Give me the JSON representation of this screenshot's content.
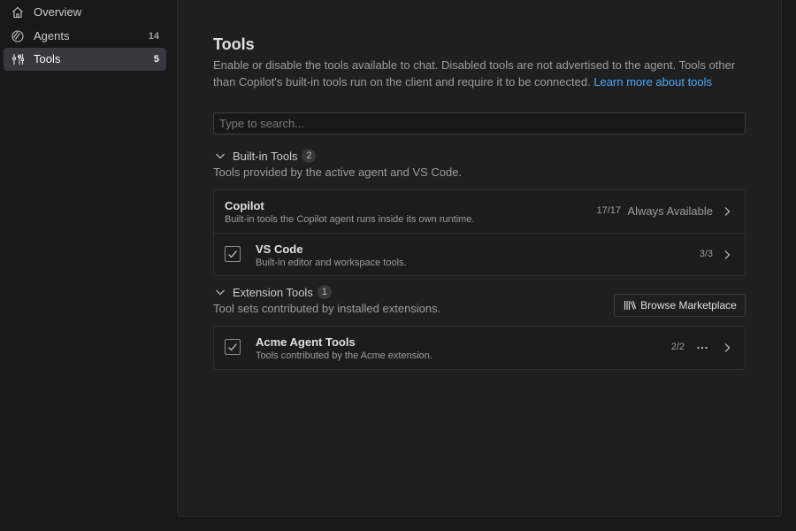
{
  "sidebar": {
    "items": [
      {
        "label": "Overview",
        "icon": "home-icon",
        "count": ""
      },
      {
        "label": "Agents",
        "icon": "agents-icon",
        "count": "14"
      },
      {
        "label": "Tools",
        "icon": "tools-icon",
        "count": "5",
        "active": true
      }
    ]
  },
  "main": {
    "title": "Tools",
    "description": "Enable or disable the tools available to chat. Disabled tools are not advertised to the agent. Tools other than Copilot's built-in tools run on the client and require it to be connected.",
    "learn_more": "Learn more about tools",
    "search_placeholder": "Type to search...",
    "sections": [
      {
        "title": "Built-in Tools",
        "count": "2",
        "description": "Tools provided by the active agent and VS Code.",
        "items": [
          {
            "name": "Copilot",
            "description": "Built-in tools the Copilot agent runs inside its own runtime.",
            "count": "17/17",
            "status": "Always Available",
            "checkbox": false
          },
          {
            "name": "VS Code",
            "description": "Built-in editor and workspace tools.",
            "count": "3/3",
            "checkbox": true,
            "checked": true
          }
        ]
      },
      {
        "title": "Extension Tools",
        "count": "1",
        "description": "Tool sets contributed by installed extensions.",
        "action_label": "Browse Marketplace",
        "items": [
          {
            "name": "Acme Agent Tools",
            "description": "Tools contributed by the Acme extension.",
            "count": "2/2",
            "checkbox": true,
            "checked": true,
            "more": true
          }
        ]
      }
    ]
  },
  "colors": {
    "background": "#181818",
    "panel": "#1f1f1f",
    "active_item": "#37373d",
    "link": "#4daafc",
    "text_muted": "#9d9d9d"
  }
}
